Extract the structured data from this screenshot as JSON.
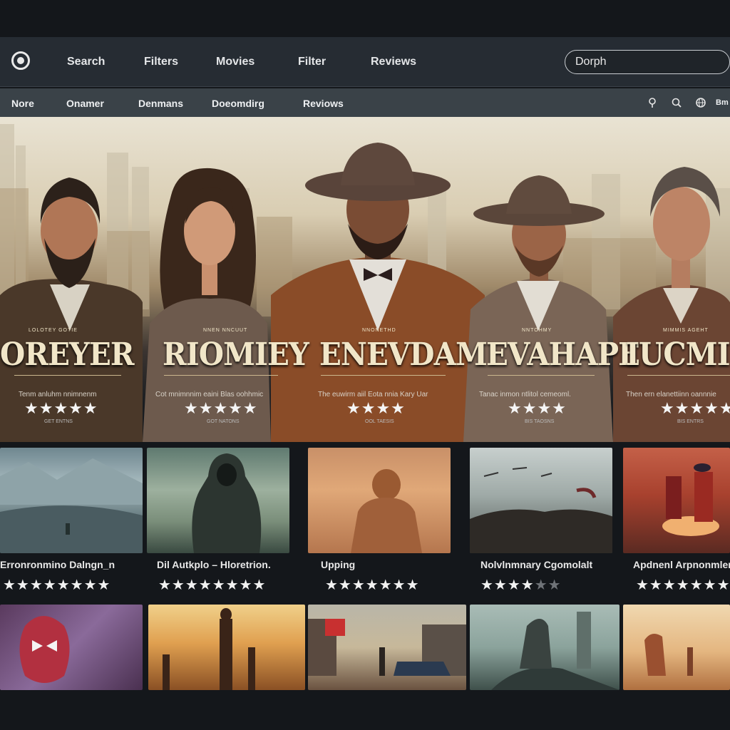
{
  "topbar": {
    "nav": [
      "Search",
      "Filters",
      "Movies",
      "Filter",
      "Reviews"
    ],
    "search_placeholder": "Dorph"
  },
  "subbar": {
    "nav": [
      "Nore",
      "Onamer",
      "Denmans",
      "Doeomdirg",
      "Reviows"
    ],
    "icons": [
      "location-pin-icon",
      "search-icon",
      "globe-icon"
    ],
    "extra_label": "Bm"
  },
  "featured": [
    {
      "title": "OREYER",
      "kicker": "LOLOTEY  GOTIE",
      "tagline": "Tenm anluhm nnimnenm",
      "stars": "★★★★★",
      "sub": "GET ENTNS"
    },
    {
      "title": "RIOMIEY",
      "kicker": "NNEN  NNCUUT",
      "tagline": "Cot mnimnnim eaini Blas oohhmic",
      "stars": "★★★★★",
      "sub": "GOT NATONS"
    },
    {
      "title": "ENEVDAM",
      "kicker": "NNONETHD",
      "tagline": "The euwirm aiil Eota nnia Kary Uar",
      "stars": "★★★★",
      "sub": "OOL TAESIS"
    },
    {
      "title": "EVAHAPE",
      "kicker": "NNTOHMY",
      "tagline": "Tanac inmon ntlitol cemeoml.",
      "stars": "★★★★",
      "sub": "BIS TAOSNS"
    },
    {
      "title": "IUCMIFT",
      "kicker": "MIMMIS  AGEHT",
      "tagline": "Then ern elanettiinn oannnie",
      "stars": "★★★★★",
      "sub": "BIS ENTRS"
    }
  ],
  "cards": [
    {
      "caption": "Erronronmino Dalngn_n",
      "stars": "★★★★★★★★",
      "rating": 8,
      "max": 8
    },
    {
      "caption": "Dil Autkplo – Hloretrion.",
      "stars": "★★★★★★★★",
      "rating": 8,
      "max": 8
    },
    {
      "caption": "Upping",
      "stars": "★★★★★★★",
      "rating": 7,
      "max": 7
    },
    {
      "caption": "Nolvlnmnary Cgomolalt",
      "stars": "★★★★★★",
      "rating": 4,
      "max": 6
    },
    {
      "caption": "Apdnenl Arpnonmlenno",
      "stars": "★★★★★★★",
      "rating": 7,
      "max": 7
    },
    {
      "caption": "",
      "stars": ""
    },
    {
      "caption": "",
      "stars": ""
    },
    {
      "caption": "",
      "stars": ""
    },
    {
      "caption": "",
      "stars": ""
    },
    {
      "caption": "",
      "stars": ""
    }
  ],
  "colors": {
    "topbar": "#262c33",
    "subbar": "#3a4248",
    "page_background": "#14171b",
    "title_gold": "#f1e6c8"
  }
}
